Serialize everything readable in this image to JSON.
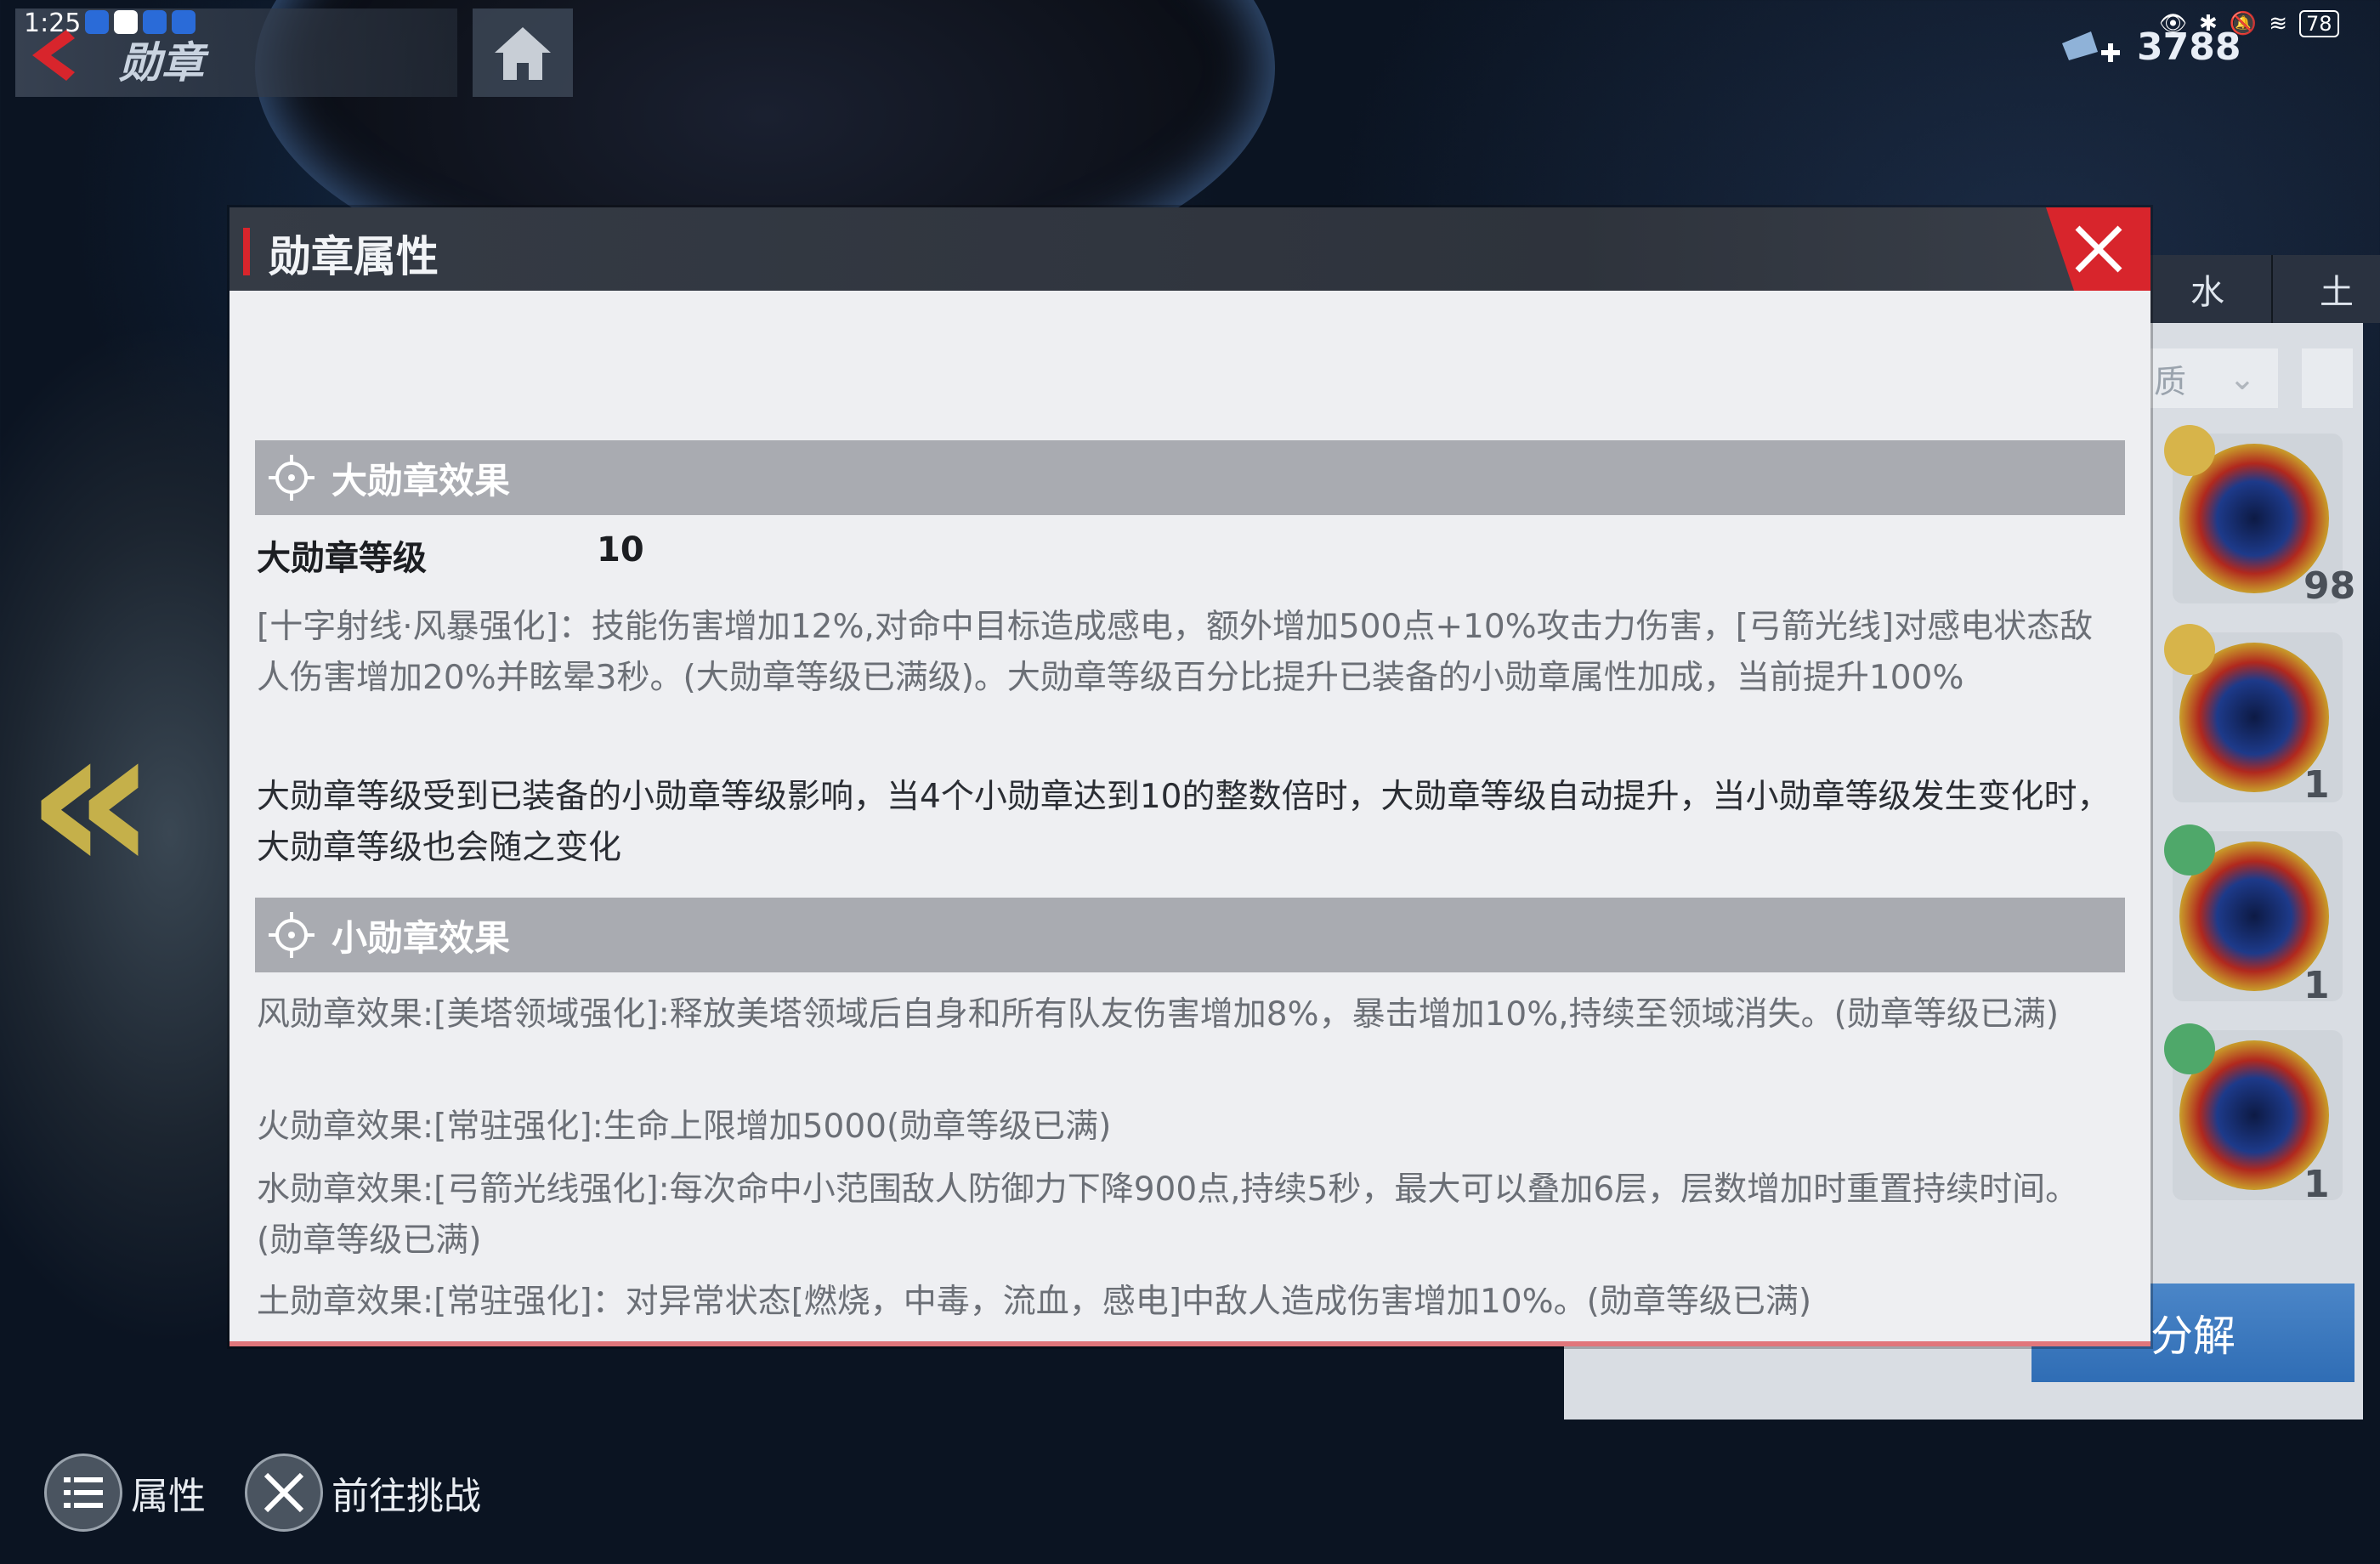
{
  "status_bar": {
    "time": "1:25",
    "battery": "78"
  },
  "top_nav": {
    "title": "勋章",
    "currency_value": "3788"
  },
  "element_tabs": [
    "水",
    "土"
  ],
  "sort_label": "质",
  "medals": [
    {
      "count": "98"
    },
    {
      "count": "1"
    },
    {
      "count": "1"
    },
    {
      "count": "1"
    }
  ],
  "decompose_label": "分解",
  "bottom_buttons": {
    "attributes": "属性",
    "challenge": "前往挑战"
  },
  "modal": {
    "title": "勋章属性",
    "big_section": {
      "header": "大勋章效果",
      "level_label": "大勋章等级",
      "level_value": "10",
      "desc1": "[十字射线·风暴强化]：技能伤害增加12%,对命中目标造成感电，额外增加500点+10%攻击力伤害，[弓箭光线]对感电状态敌人伤害增加20%并眩晕3秒。(大勋章等级已满级)。大勋章等级百分比提升已装备的小勋章属性加成，当前提升100%",
      "desc2": "大勋章等级受到已装备的小勋章等级影响，当4个小勋章达到10的整数倍时，大勋章等级自动提升，当小勋章等级发生变化时，大勋章等级也会随之变化"
    },
    "small_section": {
      "header": "小勋章效果",
      "wind": "风勋章效果:[美塔领域强化]:释放美塔领域后自身和所有队友伤害增加8%，暴击增加10%,持续至领域消失。(勋章等级已满)",
      "fire": "火勋章效果:[常驻强化]:生命上限增加5000(勋章等级已满)",
      "water": "水勋章效果:[弓箭光线强化]:每次命中小范围敌人防御力下降900点,持续5秒，最大可以叠加6层，层数增加时重置持续时间。(勋章等级已满)",
      "earth": "土勋章效果:[常驻强化]：对异常状态[燃烧，中毒，流血，感电]中敌人造成伤害增加10%。(勋章等级已满)"
    }
  }
}
